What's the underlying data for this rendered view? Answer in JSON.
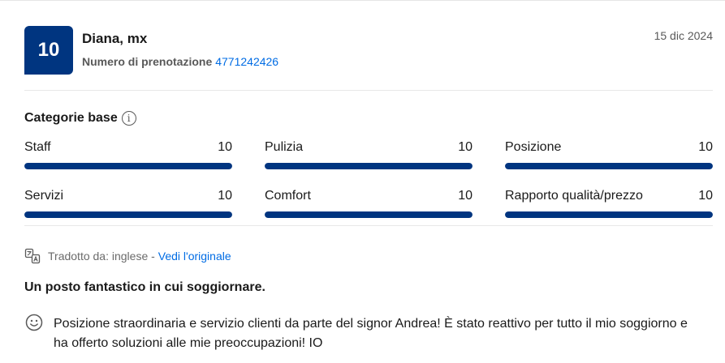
{
  "review": {
    "score": "10",
    "name": "Diana, mx",
    "booking_label": "Numero di prenotazione",
    "booking_number": "4771242426",
    "date": "15 dic 2024"
  },
  "categories": {
    "title": "Categorie base",
    "info_icon": "info-icon",
    "items": [
      {
        "label": "Staff",
        "score": "10",
        "fill_fraction": 1.0
      },
      {
        "label": "Pulizia",
        "score": "10",
        "fill_fraction": 1.0
      },
      {
        "label": "Posizione",
        "score": "10",
        "fill_fraction": 1.0
      },
      {
        "label": "Servizi",
        "score": "10",
        "fill_fraction": 1.0
      },
      {
        "label": "Comfort",
        "score": "10",
        "fill_fraction": 1.0
      },
      {
        "label": "Rapporto qualità/prezzo",
        "score": "10",
        "fill_fraction": 1.0
      }
    ]
  },
  "translation": {
    "icon": "translate-icon",
    "text": "Tradotto da: inglese -",
    "link": "Vedi l'originale"
  },
  "body": {
    "title": "Un posto fantastico in cui soggiornare.",
    "positive_icon": "smile-icon",
    "positive_text": "Posizione straordinaria e servizio clienti da parte del signor Andrea! È stato reattivo per tutto il mio soggiorno e ha offerto soluzioni alle mie preoccupazioni! IO"
  },
  "colors": {
    "brand": "#003580",
    "link": "#006ce4",
    "track": "#e7e7e7"
  }
}
